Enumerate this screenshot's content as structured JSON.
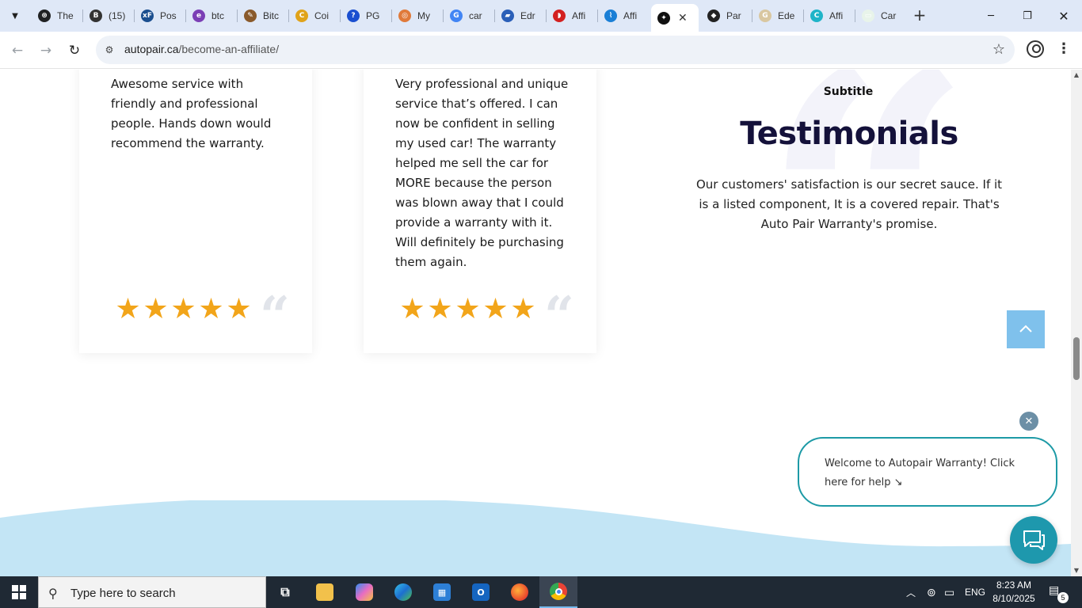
{
  "browser": {
    "tabs": [
      {
        "label": "The",
        "favicon": "openai-icon",
        "color": "#202123",
        "glyph": "⊛"
      },
      {
        "label": "(15)",
        "favicon": "b-icon",
        "color": "#333333",
        "glyph": "B"
      },
      {
        "label": "Pos",
        "favicon": "xenforo-icon",
        "color": "#1b4f8f",
        "glyph": "xF"
      },
      {
        "label": "btc",
        "favicon": "e-icon",
        "color": "#7b3fb5",
        "glyph": "e"
      },
      {
        "label": "Bitc",
        "favicon": "pen-icon",
        "color": "#8a5a2b",
        "glyph": "✎"
      },
      {
        "label": "Coi",
        "favicon": "c-icon",
        "color": "#e0a31a",
        "glyph": "C"
      },
      {
        "label": "PG",
        "favicon": "question-icon",
        "color": "#1a4fd0",
        "glyph": "?"
      },
      {
        "label": "My",
        "favicon": "swirl-icon",
        "color": "#e07a3a",
        "glyph": "◎"
      },
      {
        "label": "car",
        "favicon": "google-icon",
        "color": "#4285f4",
        "glyph": "G"
      },
      {
        "label": "Edr",
        "favicon": "car-icon",
        "color": "#2a5fb8",
        "glyph": "▰"
      },
      {
        "label": "Affi",
        "favicon": "red-bolt-icon",
        "color": "#d32020",
        "glyph": "◗"
      },
      {
        "label": "Affi",
        "favicon": "blue-stripe-icon",
        "color": "#1a7fd6",
        "glyph": "⌇"
      },
      {
        "label": "",
        "favicon": "autopair-icon",
        "color": "#111111",
        "glyph": "✦",
        "active": true
      },
      {
        "label": "Par",
        "favicon": "binance-icon",
        "color": "#222222",
        "glyph": "◆"
      },
      {
        "label": "Ede",
        "favicon": "ede-icon",
        "color": "#d9c7a0",
        "glyph": "G"
      },
      {
        "label": "Affi",
        "favicon": "c-cyan-icon",
        "color": "#1fb4c8",
        "glyph": "C"
      },
      {
        "label": "Car",
        "favicon": "flag-icon",
        "color": "#e8f4ea",
        "glyph": "▭"
      }
    ],
    "url_domain": "autopair.ca",
    "url_path": "/become-an-affiliate/"
  },
  "page": {
    "testimonials": [
      {
        "text": "Awesome service with friendly and professional people. Hands down would recommend the warranty.",
        "rating": 5
      },
      {
        "text": "Very professional and unique service that’s offered. I can now be confident in selling my used car! The warranty helped me sell the car for MORE because the person was blown away that I could provide a warranty with it. Will definitely be purchasing them again.",
        "rating": 5
      }
    ],
    "star_glyph": "★",
    "quote_glyph": "“",
    "subtitle": "Subtitle",
    "title": "Testimonials",
    "description": "Our customers' satisfaction is our secret sauce. If it is a listed component, It is a covered repair. That's Auto Pair Warranty's promise.",
    "chat_message": "Welcome to Autopair Warranty! Click here for help ↘",
    "star_color": "#f2a51a",
    "accent_color": "#1e98ad"
  },
  "taskbar": {
    "search_placeholder": "Type here to search",
    "language": "ENG",
    "time": "8:23 AM",
    "date": "8/10/2025",
    "notification_count": "5"
  }
}
